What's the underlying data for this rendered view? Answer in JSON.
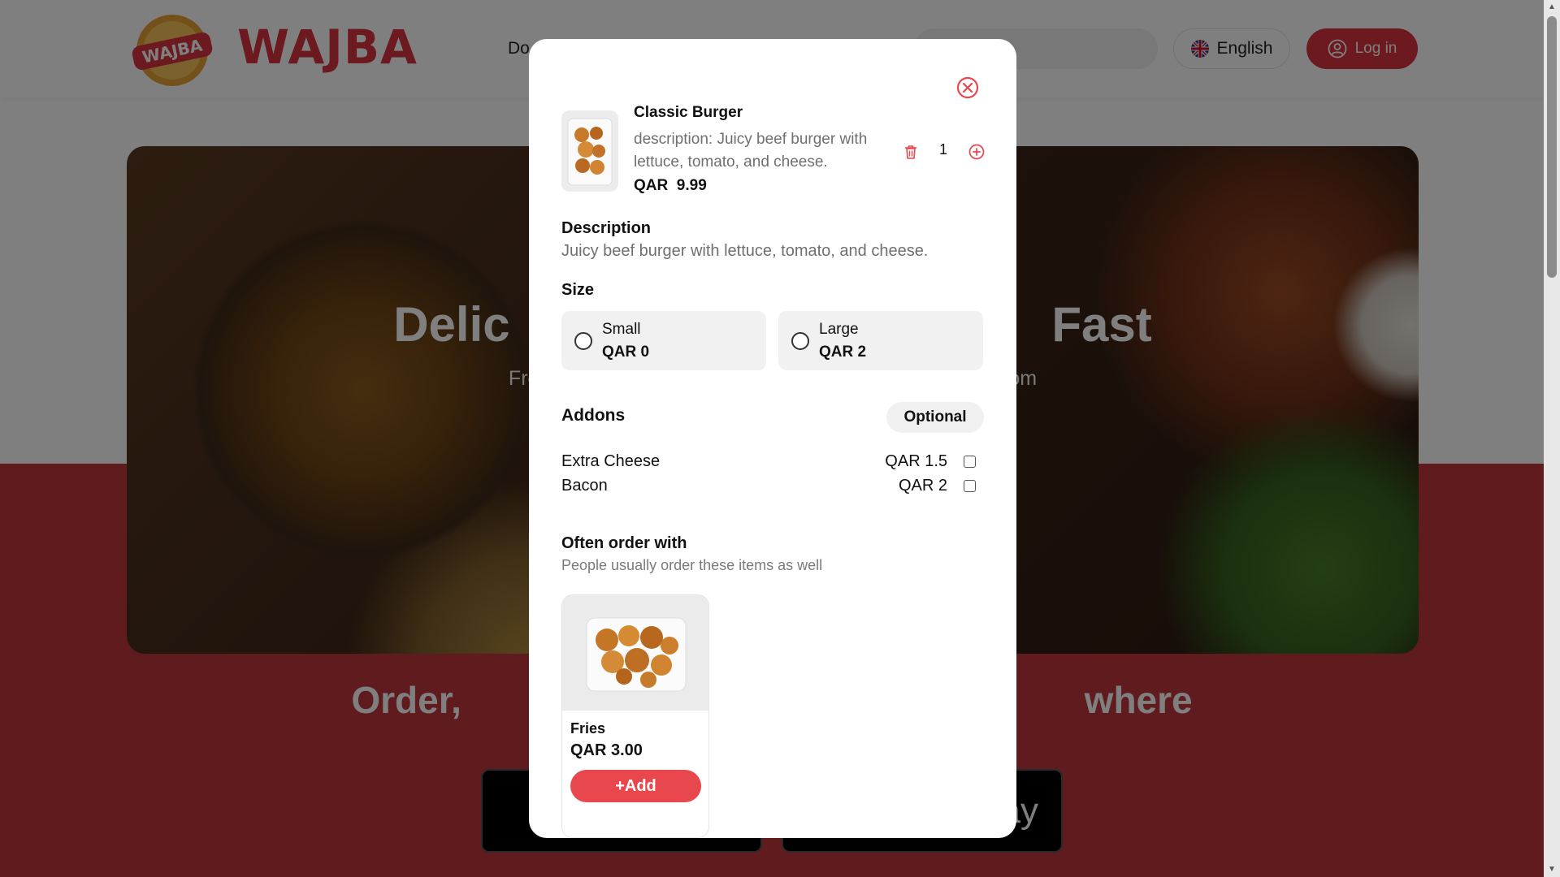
{
  "header": {
    "logo_badge_text": "WAJBA",
    "logo_text": "WAJBA",
    "nav_link": "Do",
    "language_label": "English",
    "login_label": "Log in"
  },
  "hero": {
    "title": "Delic                                        Fast",
    "subtitle": "Fresh ing                                                                rder from"
  },
  "download": {
    "title": "Order,                                                            where",
    "google_partial": "ay"
  },
  "modal": {
    "item": {
      "name": "Classic Burger",
      "description": "description: Juicy beef burger with lettuce, tomato, and cheese.",
      "price": "QAR  9.99",
      "quantity": "1"
    },
    "description_section": {
      "label": "Description",
      "text": "Juicy beef burger with lettuce, tomato, and cheese."
    },
    "size_section": {
      "label": "Size",
      "options": [
        {
          "name": "Small",
          "price": "QAR 0"
        },
        {
          "name": "Large",
          "price": "QAR 2"
        }
      ]
    },
    "addons_section": {
      "label": "Addons",
      "badge": "Optional",
      "items": [
        {
          "name": "Extra Cheese",
          "price": "QAR 1.5"
        },
        {
          "name": "Bacon",
          "price": "QAR 2"
        }
      ]
    },
    "often_section": {
      "label": "Often order with",
      "subtitle": "People usually order these items as well",
      "items": [
        {
          "name": "Fries",
          "price": "QAR 3.00",
          "button": "+Add"
        }
      ]
    }
  },
  "colors": {
    "brand_red": "#d9343f",
    "add_button": "#e8474d",
    "section_red": "#c0363c"
  },
  "icons": {
    "close": "circle-x-icon",
    "delete": "trash-icon",
    "increment": "plus-circle-icon",
    "user": "user-circle-icon",
    "flag": "uk-flag-icon"
  }
}
